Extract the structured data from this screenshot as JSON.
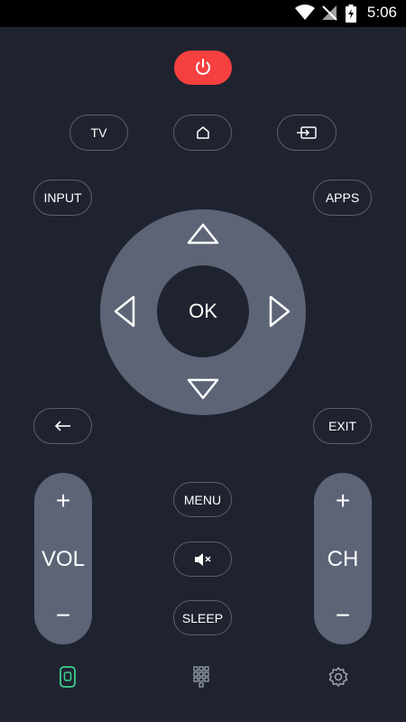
{
  "status_bar": {
    "time": "5:06"
  },
  "remote": {
    "tv_label": "TV",
    "input_label": "INPUT",
    "apps_label": "APPS",
    "ok_label": "OK",
    "exit_label": "EXIT",
    "menu_label": "MENU",
    "sleep_label": "SLEEP",
    "vol": {
      "label": "VOL",
      "plus": "+",
      "minus": "−"
    },
    "ch": {
      "label": "CH",
      "plus": "+",
      "minus": "−"
    }
  },
  "colors": {
    "background": "#1f2330",
    "power": "#f5403f",
    "pad": "#5c6476",
    "active_nav": "#3ecf8e"
  },
  "bottom_nav": [
    {
      "icon": "remote-icon",
      "active": true
    },
    {
      "icon": "keypad-icon",
      "active": false
    },
    {
      "icon": "settings-icon",
      "active": false
    }
  ]
}
